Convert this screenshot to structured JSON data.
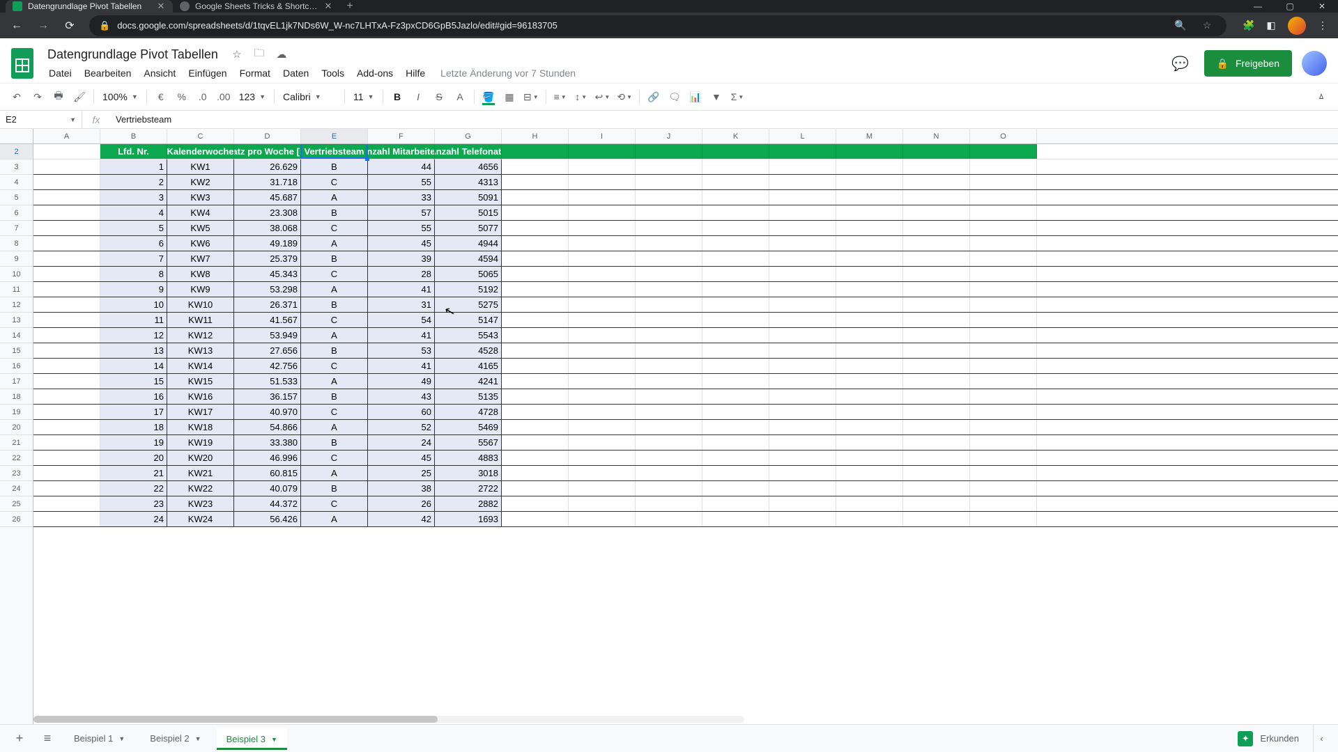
{
  "browser": {
    "tabs": [
      {
        "title": "Datengrundlage Pivot Tabellen",
        "active": true
      },
      {
        "title": "Google Sheets Tricks & Shortcuts",
        "active": false
      }
    ],
    "url": "docs.google.com/spreadsheets/d/1tqvEL1jk7NDs6W_W-nc7LHTxA-Fz3pxCD6GpB5Jazlo/edit#gid=96183705",
    "win": {
      "min": "—",
      "max": "▢",
      "close": "✕"
    }
  },
  "doc": {
    "title": "Datengrundlage Pivot Tabellen",
    "last_edit": "Letzte Änderung vor 7 Stunden",
    "share_label": "Freigeben"
  },
  "menus": [
    "Datei",
    "Bearbeiten",
    "Ansicht",
    "Einfügen",
    "Format",
    "Daten",
    "Tools",
    "Add-ons",
    "Hilfe"
  ],
  "toolbar": {
    "zoom": "100%",
    "num_format": "123",
    "font": "Calibri",
    "size": "11"
  },
  "namebox": "E2",
  "formula": "Vertriebsteam",
  "columns": [
    "A",
    "B",
    "C",
    "D",
    "E",
    "F",
    "G",
    "H",
    "I",
    "J",
    "K",
    "L",
    "M",
    "N",
    "O"
  ],
  "col_widths": {
    "A": 96,
    "B": 96,
    "C": 96,
    "D": 96,
    "E": 96,
    "F": 96,
    "G": 96,
    "rest": 96
  },
  "selected_col": "E",
  "selected_row": 2,
  "header": {
    "B": "Lfd. Nr.",
    "C": "Kalenderwoche",
    "D": "atz pro Woche [I",
    "E": "Vertriebsteam",
    "F": "nzahl Mitarbeite",
    "G": "Anzahl Telefonate"
  },
  "rows_start": 2,
  "data": [
    {
      "n": 1,
      "kw": "KW1",
      "d": "26.629",
      "team": "B",
      "m": 44,
      "t": 4656
    },
    {
      "n": 2,
      "kw": "KW2",
      "d": "31.718",
      "team": "C",
      "m": 55,
      "t": 4313
    },
    {
      "n": 3,
      "kw": "KW3",
      "d": "45.687",
      "team": "A",
      "m": 33,
      "t": 5091
    },
    {
      "n": 4,
      "kw": "KW4",
      "d": "23.308",
      "team": "B",
      "m": 57,
      "t": 5015
    },
    {
      "n": 5,
      "kw": "KW5",
      "d": "38.068",
      "team": "C",
      "m": 55,
      "t": 5077
    },
    {
      "n": 6,
      "kw": "KW6",
      "d": "49.189",
      "team": "A",
      "m": 45,
      "t": 4944
    },
    {
      "n": 7,
      "kw": "KW7",
      "d": "25.379",
      "team": "B",
      "m": 39,
      "t": 4594
    },
    {
      "n": 8,
      "kw": "KW8",
      "d": "45.343",
      "team": "C",
      "m": 28,
      "t": 5065
    },
    {
      "n": 9,
      "kw": "KW9",
      "d": "53.298",
      "team": "A",
      "m": 41,
      "t": 5192
    },
    {
      "n": 10,
      "kw": "KW10",
      "d": "26.371",
      "team": "B",
      "m": 31,
      "t": 5275
    },
    {
      "n": 11,
      "kw": "KW11",
      "d": "41.567",
      "team": "C",
      "m": 54,
      "t": 5147
    },
    {
      "n": 12,
      "kw": "KW12",
      "d": "53.949",
      "team": "A",
      "m": 41,
      "t": 5543
    },
    {
      "n": 13,
      "kw": "KW13",
      "d": "27.656",
      "team": "B",
      "m": 53,
      "t": 4528
    },
    {
      "n": 14,
      "kw": "KW14",
      "d": "42.756",
      "team": "C",
      "m": 41,
      "t": 4165
    },
    {
      "n": 15,
      "kw": "KW15",
      "d": "51.533",
      "team": "A",
      "m": 49,
      "t": 4241
    },
    {
      "n": 16,
      "kw": "KW16",
      "d": "36.157",
      "team": "B",
      "m": 43,
      "t": 5135
    },
    {
      "n": 17,
      "kw": "KW17",
      "d": "40.970",
      "team": "C",
      "m": 60,
      "t": 4728
    },
    {
      "n": 18,
      "kw": "KW18",
      "d": "54.866",
      "team": "A",
      "m": 52,
      "t": 5469
    },
    {
      "n": 19,
      "kw": "KW19",
      "d": "33.380",
      "team": "B",
      "m": 24,
      "t": 5567
    },
    {
      "n": 20,
      "kw": "KW20",
      "d": "46.996",
      "team": "C",
      "m": 45,
      "t": 4883
    },
    {
      "n": 21,
      "kw": "KW21",
      "d": "60.815",
      "team": "A",
      "m": 25,
      "t": 3018
    },
    {
      "n": 22,
      "kw": "KW22",
      "d": "40.079",
      "team": "B",
      "m": 38,
      "t": 2722
    },
    {
      "n": 23,
      "kw": "KW23",
      "d": "44.372",
      "team": "C",
      "m": 26,
      "t": 2882
    },
    {
      "n": 24,
      "kw": "KW24",
      "d": "56.426",
      "team": "A",
      "m": 42,
      "t": 1693
    }
  ],
  "sheet_tabs": [
    {
      "label": "Beispiel 1",
      "active": false
    },
    {
      "label": "Beispiel 2",
      "active": false
    },
    {
      "label": "Beispiel 3",
      "active": true
    }
  ],
  "explore_label": "Erkunden"
}
